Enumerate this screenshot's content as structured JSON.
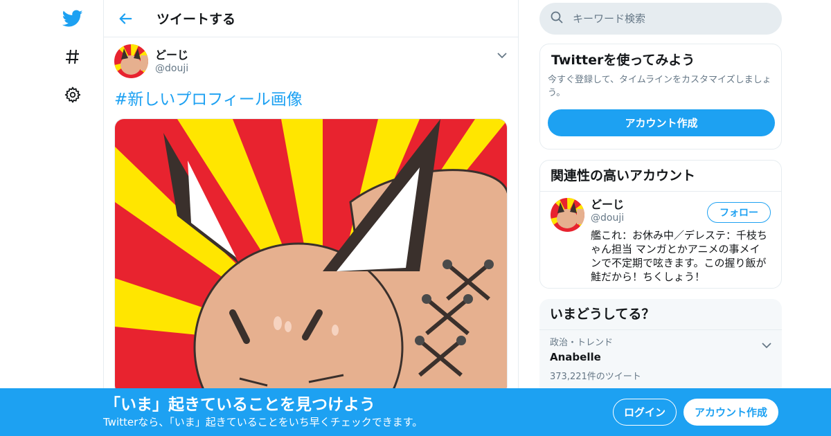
{
  "colors": {
    "accent": "#1da1f2",
    "border": "#e6ecf0",
    "muted": "#657786"
  },
  "nav": {
    "icons": [
      "twitter-bird-icon",
      "hashtag-icon",
      "gear-icon"
    ]
  },
  "header": {
    "title": "ツイートする"
  },
  "tweet": {
    "author_name": "どーじ",
    "author_handle": "@douji",
    "hashtag": "#新しいプロフィール画像"
  },
  "search": {
    "placeholder": "キーワード検索"
  },
  "signup_card": {
    "title": "Twitterを使ってみよう",
    "desc": "今すぐ登録して、タイムラインをカスタマイズしましょう。",
    "button": "アカウント作成"
  },
  "related": {
    "title": "関連性の高いアカウント",
    "name": "どーじ",
    "handle": "@douji",
    "follow": "フォロー",
    "bio": "艦これ：お休み中／デレステ：千枝ちゃん担当 マンガとかアニメの事メインで不定期で呟きます。この握り飯が鮭だから！ちくしょう！"
  },
  "trends": {
    "title": "いまどうしてる？",
    "items": [
      {
        "category": "政治・トレンド",
        "name": "Anabelle",
        "count": "373,221件のツイート"
      }
    ]
  },
  "banner": {
    "title": "「いま」起きていることを見つけよう",
    "subtitle": "Twitterなら、「いま」起きていることをいち早くチェックできます。",
    "login": "ログイン",
    "signup": "アカウント作成"
  }
}
